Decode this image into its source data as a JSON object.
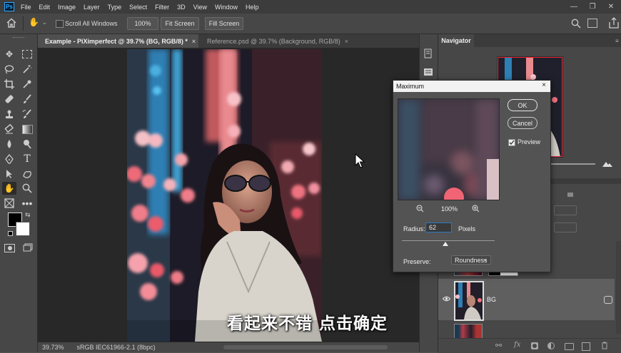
{
  "app": {
    "logo": "Ps"
  },
  "menubar": {
    "items": [
      "File",
      "Edit",
      "Image",
      "Layer",
      "Type",
      "Select",
      "Filter",
      "3D",
      "View",
      "Window",
      "Help"
    ]
  },
  "window_controls": {
    "minimize": "—",
    "restore": "❐",
    "close": "✕"
  },
  "options": {
    "scroll_all_label": "Scroll All Windows",
    "scroll_all_checked": false,
    "zoom_button": "100%",
    "fit_screen": "Fit Screen",
    "fill_screen": "Fill Screen"
  },
  "tabs": [
    {
      "label": "Example - PiXimperfect @ 39.7% (BG, RGB/8) *",
      "close": "×",
      "active": true
    },
    {
      "label": "Reference.psd @ 39.7% (Background, RGB/8)",
      "close": "×",
      "active": false
    }
  ],
  "status": {
    "zoom": "39.73%",
    "profile": "sRGB IEC61966-2.1 (8bpc)"
  },
  "navigator": {
    "title": "Navigator"
  },
  "dialog": {
    "title": "Maximum",
    "ok": "OK",
    "cancel": "Cancel",
    "preview_label": "Preview",
    "preview_checked": true,
    "zoom": "100%",
    "radius_label": "Radius:",
    "radius_value": "62",
    "radius_unit": "Pixels",
    "radius_slider_fraction": 0.47,
    "preserve_label": "Preserve:",
    "preserve_value": "Roundness"
  },
  "layers": {
    "bg_name": "BG"
  },
  "subtitle": "看起来不错 点击确定",
  "colors": {
    "accent": "#31a8ff",
    "foreground": "#000000",
    "background": "#ffffff"
  }
}
